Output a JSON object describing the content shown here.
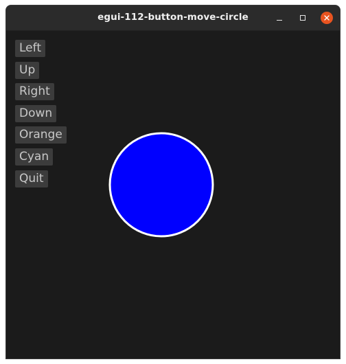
{
  "window": {
    "title": "egui-112-button-move-circle"
  },
  "buttons": [
    {
      "label": "Left"
    },
    {
      "label": "Up"
    },
    {
      "label": "Right"
    },
    {
      "label": "Down"
    },
    {
      "label": "Orange"
    },
    {
      "label": "Cyan"
    },
    {
      "label": "Quit"
    }
  ],
  "circle": {
    "fill_color": "#0000ff",
    "stroke_color": "#ffffff"
  },
  "colors": {
    "background": "#1b1b1b",
    "button_bg": "#3c3c3c",
    "button_text": "#c8c8c8",
    "close_button": "#e95420"
  }
}
